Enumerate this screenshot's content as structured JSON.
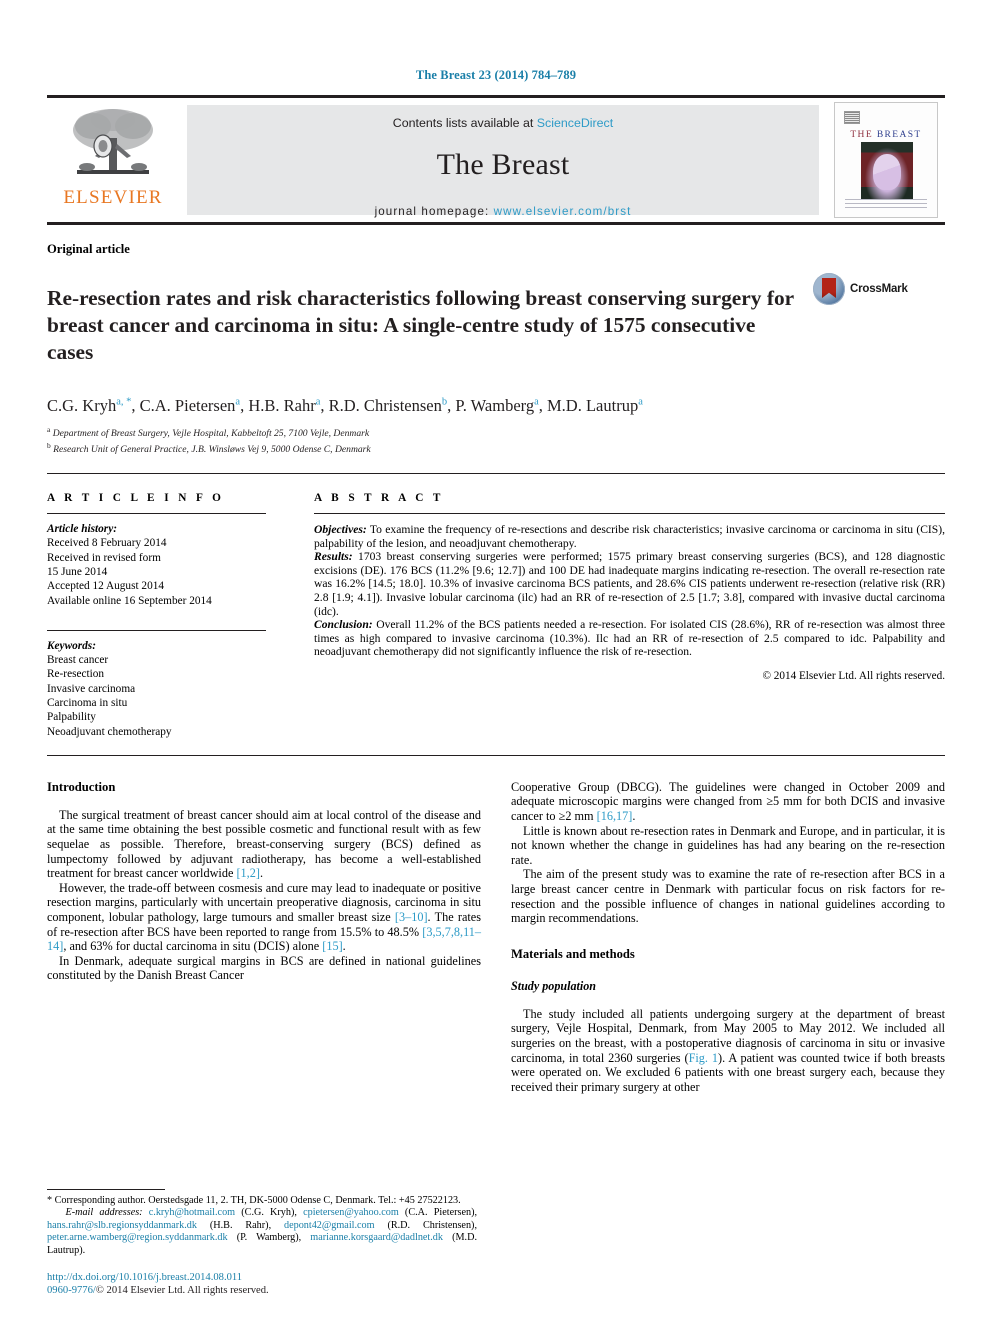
{
  "running_head": "The Breast 23 (2014) 784–789",
  "masthead": {
    "publisher_name": "ELSEVIER",
    "publisher_logo_icon": "elsevier-tree-logo",
    "contents_prefix": "Contents lists available at ",
    "contents_link": "ScienceDirect",
    "journal_title": "The Breast",
    "homepage_prefix": "journal homepage: ",
    "homepage_url": "www.elsevier.com/brst",
    "cover": {
      "title_part1": "THE ",
      "title_part2": "BREAST",
      "art_icon": "journal-cover-artwork"
    }
  },
  "article": {
    "type": "Original article",
    "title": "Re-resection rates and risk characteristics following breast conserving surgery for breast cancer and carcinoma in situ: A single-centre study of 1575 consecutive cases",
    "crossmark_label": "CrossMark",
    "authors": [
      {
        "name": "C.G. Kryh",
        "marks": "a, *"
      },
      {
        "name": "C.A. Pietersen",
        "marks": "a"
      },
      {
        "name": "H.B. Rahr",
        "marks": "a"
      },
      {
        "name": "R.D. Christensen",
        "marks": "b"
      },
      {
        "name": "P. Wamberg",
        "marks": "a"
      },
      {
        "name": "M.D. Lautrup",
        "marks": "a"
      }
    ],
    "affiliations": [
      {
        "mark": "a",
        "text": "Department of Breast Surgery, Vejle Hospital, Kabbeltoft 25, 7100 Vejle, Denmark"
      },
      {
        "mark": "b",
        "text": "Research Unit of General Practice, J.B. Winsløws Vej 9, 5000 Odense C, Denmark"
      }
    ]
  },
  "article_info": {
    "heading": "A R T I C L E  I N F O",
    "history_label": "Article history:",
    "history": [
      "Received 8 February 2014",
      "Received in revised form",
      "15 June 2014",
      "Accepted 12 August 2014",
      "Available online 16 September 2014"
    ],
    "keywords_label": "Keywords:",
    "keywords": [
      "Breast cancer",
      "Re-resection",
      "Invasive carcinoma",
      "Carcinoma in situ",
      "Palpability",
      "Neoadjuvant chemotherapy"
    ]
  },
  "abstract": {
    "heading": "A B S T R A C T",
    "objectives_label": "Objectives:",
    "objectives_text": " To examine the frequency of re-resections and describe risk characteristics; invasive carcinoma or carcinoma in situ (CIS), palpability of the lesion, and neoadjuvant chemotherapy.",
    "results_label": "Results:",
    "results_text": " 1703 breast conserving surgeries were performed; 1575 primary breast conserving surgeries (BCS), and 128 diagnostic excisions (DE). 176 BCS (11.2% [9.6; 12.7]) and 100 DE had inadequate margins indicating re-resection. The overall re-resection rate was 16.2% [14.5; 18.0]. 10.3% of invasive carcinoma BCS patients, and 28.6% CIS patients underwent re-resection (relative risk (RR) 2.8 [1.9; 4.1]). Invasive lobular carcinoma (ilc) had an RR of re-resection of 2.5 [1.7; 3.8], compared with invasive ductal carcinoma (idc).",
    "conclusion_label": "Conclusion:",
    "conclusion_text": " Overall 11.2% of the BCS patients needed a re-resection. For isolated CIS (28.6%), RR of re-resection was almost three times as high compared to invasive carcinoma (10.3%). Ilc had an RR of re-resection of 2.5 compared to idc. Palpability and neoadjuvant chemotherapy did not significantly influence the risk of re-resection.",
    "copyright": "© 2014 Elsevier Ltd. All rights reserved."
  },
  "body": {
    "left": {
      "heading_introduction": "Introduction",
      "p1_a": "The surgical treatment of breast cancer should aim at local control of the disease and at the same time obtaining the best possible cosmetic and functional result with as few sequelae as possible. Therefore, breast-conserving surgery (BCS) defined as lumpectomy followed by adjuvant radiotherapy, has become a well-established treatment for breast cancer worldwide ",
      "p1_ref": "[1,2]",
      "p1_b": ".",
      "p2_a": "However, the trade-off between cosmesis and cure may lead to inadequate or positive resection margins, particularly with uncertain preoperative diagnosis, carcinoma in situ component, lobular pathology, large tumours and smaller breast size ",
      "p2_ref1": "[3–10]",
      "p2_b": ". The rates of re-resection after BCS have been reported to range from 15.5% to 48.5% ",
      "p2_ref2": "[3,5,7,8,11–14]",
      "p2_c": ", and 63% for ductal carcinoma in situ (DCIS) alone ",
      "p2_ref3": "[15]",
      "p2_d": ".",
      "p3": "In Denmark, adequate surgical margins in BCS are defined in national guidelines constituted by the Danish Breast Cancer"
    },
    "right": {
      "p4_a": "Cooperative Group (DBCG). The guidelines were changed in October 2009 and adequate microscopic margins were changed from ≥5 mm for both DCIS and invasive cancer to ≥2 mm ",
      "p4_ref": "[16,17]",
      "p4_b": ".",
      "p5": "Little is known about re-resection rates in Denmark and Europe, and in particular, it is not known whether the change in guidelines has had any bearing on the re-resection rate.",
      "p6": "The aim of the present study was to examine the rate of re-resection after BCS in a large breast cancer centre in Denmark with particular focus on risk factors for re-resection and the possible influence of changes in national guidelines according to margin recommendations.",
      "heading_materials": "Materials and methods",
      "heading_study_population": "Study population",
      "p7_a": "The study included all patients undergoing surgery at the department of breast surgery, Vejle Hospital, Denmark, from May 2005 to May 2012. We included all surgeries on the breast, with a postoperative diagnosis of carcinoma in situ or invasive carcinoma, in total 2360 surgeries (",
      "p7_ref": "Fig. 1",
      "p7_b": "). A patient was counted twice if both breasts were operated on. We excluded 6 patients with one breast surgery each, because they received their primary surgery at other"
    }
  },
  "footnotes": {
    "corresponding_marker": "*",
    "corresponding_text": " Corresponding author. Oerstedsgade 11, 2. TH, DK-5000 Odense C, Denmark. Tel.: +45 27522123.",
    "email_label": "E-mail addresses:",
    "emails": [
      {
        "address": "c.kryh@hotmail.com",
        "owner": " (C.G. Kryh), "
      },
      {
        "address": "cpietersen@yahoo.com",
        "owner": " (C.A. Pietersen), "
      },
      {
        "address": "hans.rahr@slb.regionsyddanmark.dk",
        "owner": " (H.B. Rahr), "
      },
      {
        "address": "depont42@gmail.com",
        "owner": " (R.D. Christensen), "
      },
      {
        "address": "peter.arne.wamberg@region.syddanmark.dk",
        "owner": " (P. Wamberg), "
      },
      {
        "address": "marianne.korsgaard@dadlnet.dk",
        "owner": " (M.D. Lautrup)."
      }
    ],
    "doi": "http://dx.doi.org/10.1016/j.breast.2014.08.011",
    "issn_prefix": "0960-9776/",
    "issn_rest": "© 2014 Elsevier Ltd. All rights reserved."
  }
}
